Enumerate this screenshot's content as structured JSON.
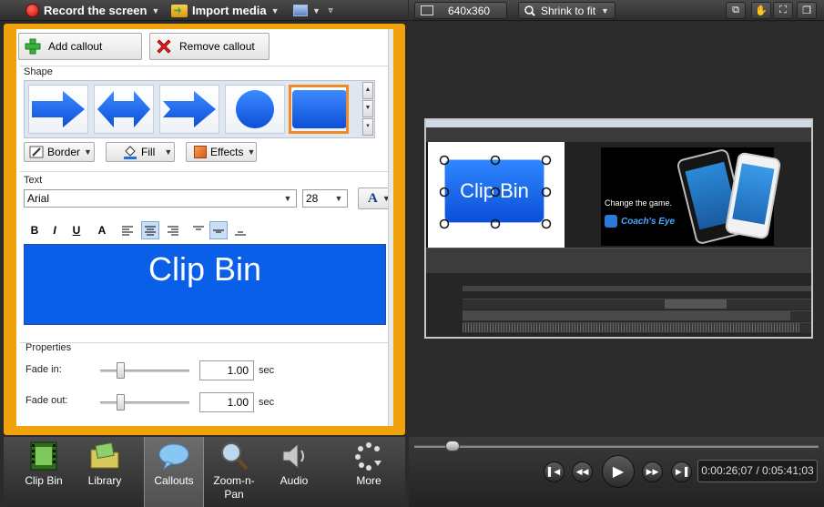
{
  "toolbar": {
    "record_label": "Record the screen",
    "import_label": "Import media"
  },
  "callouts": {
    "add_label": "Add callout",
    "remove_label": "Remove callout",
    "shape_label": "Shape",
    "border_label": "Border",
    "fill_label": "Fill",
    "effects_label": "Effects",
    "text_label": "Text",
    "font": "Arial",
    "font_size": "28",
    "preview_text": "Clip Bin",
    "properties_label": "Properties",
    "fade_in_label": "Fade in:",
    "fade_in_value": "1.00",
    "fade_out_label": "Fade out:",
    "fade_out_value": "1.00",
    "unit": "sec"
  },
  "tabs": [
    {
      "label": "Clip Bin"
    },
    {
      "label": "Library"
    },
    {
      "label": "Callouts"
    },
    {
      "label": "Zoom-n-Pan"
    },
    {
      "label": "Audio"
    },
    {
      "label": "More"
    }
  ],
  "canvas": {
    "dimensions": "640x360",
    "zoom": "Shrink to fit"
  },
  "player": {
    "timecode": "0:00:26;07 / 0:05:41;03"
  },
  "preview": {
    "callout_text": "Clip Bin",
    "tagline": "Change the game.",
    "brand": "Coach's Eye"
  },
  "colors": {
    "panel_accent": "#f0a20a",
    "callout_fill": "#0a5fe8"
  }
}
